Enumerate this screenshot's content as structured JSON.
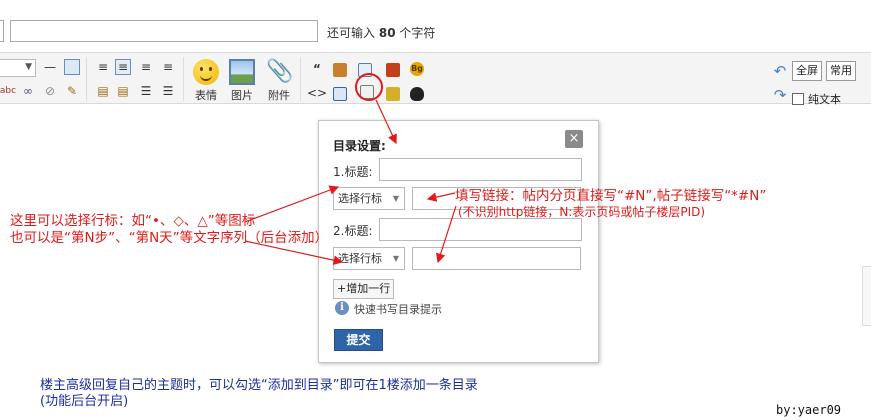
{
  "header": {
    "counter_prefix": "还可输入",
    "counter_value": "80",
    "counter_suffix": "个字符"
  },
  "toolbar": {
    "emoji_label": "表情",
    "image_label": "图片",
    "attach_label": "附件",
    "fullscreen_label": "全屏",
    "common_label": "常用",
    "plaintext_label": "纯文本"
  },
  "dialog": {
    "title": "目录设置:",
    "row1_label": "1.标题:",
    "row2_label": "2.标题:",
    "select_value": "选择行标",
    "add_row_label": "+增加一行",
    "tip_text": "快速书写目录提示",
    "submit_label": "提交",
    "close_symbol": "×"
  },
  "annotations": {
    "left_line1": "这里可以选择行标：如“•、◇、△”等图标",
    "left_line2": "也可以是“第N步”、“第N天”等文字序列（后台添加）",
    "right_line1": "填写链接：帖内分页直接写“#N”,帖子链接写“*#N”",
    "right_line2": "(不识别http链接，N:表示页码或帖子楼层PID)",
    "bottom_line1": "楼主高级回复自己的主题时，可以勾选“添加到目录”即可在1楼添加一条目录",
    "bottom_line2": "(功能后台开启)",
    "signature": "by:yaer09"
  },
  "colors": {
    "annotation_red": "#e11a1a",
    "annotation_blue": "#1b2f9e",
    "submit_blue": "#2e64a8"
  }
}
